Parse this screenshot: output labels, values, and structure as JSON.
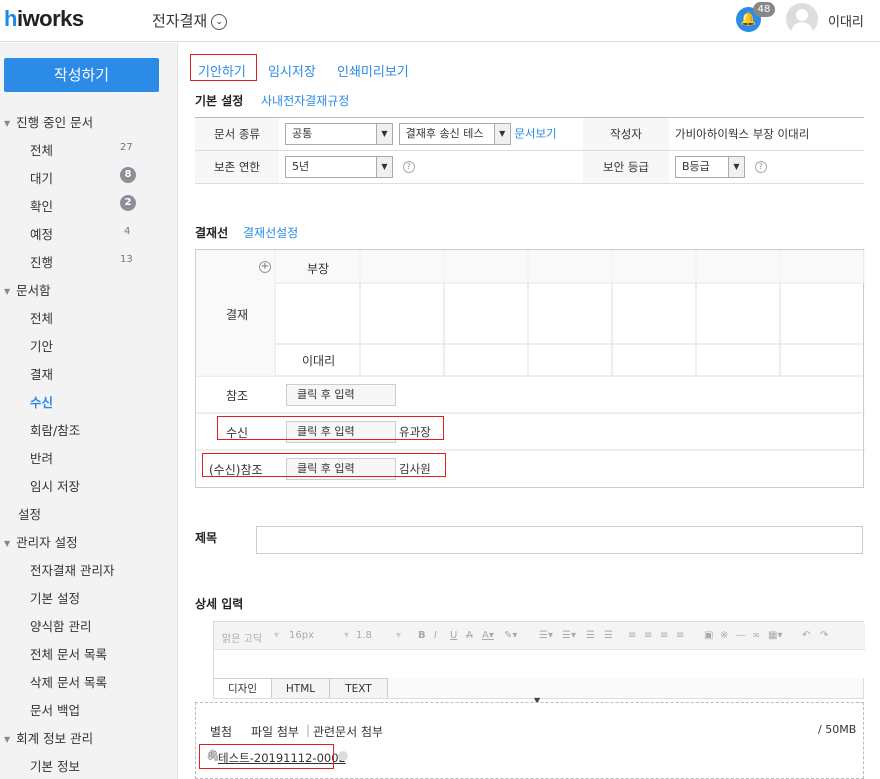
{
  "topbar": {
    "logo_h": "h",
    "logo_rest": "iworks",
    "app_title": "전자결재",
    "notif_count": "48",
    "user_name": "이대리"
  },
  "sidebar": {
    "write_button": "작성하기",
    "groups": [
      {
        "label": "진행 중인 문서"
      },
      {
        "label": "문서함"
      },
      {
        "label": "관리자 설정"
      },
      {
        "label": "회계 정보 관리"
      }
    ],
    "in_progress": [
      {
        "label": "전체",
        "count": "27"
      },
      {
        "label": "대기",
        "count": "8"
      },
      {
        "label": "확인",
        "count": "2"
      },
      {
        "label": "예정",
        "count": "4"
      },
      {
        "label": "진행",
        "count": "13"
      }
    ],
    "docbox": [
      "전체",
      "기안",
      "결재",
      "수신",
      "회람/참조",
      "반려",
      "임시 저장"
    ],
    "settings": "설정",
    "admin": [
      "전자결재 관리자",
      "기본 설정",
      "양식함 관리",
      "전체 문서 목록",
      "삭제 문서 목록",
      "문서 백업"
    ],
    "accounting": [
      "기본 정보"
    ]
  },
  "toolbar": {
    "draft": "기안하기",
    "temp_save": "임시저장",
    "print_preview": "인쇄미리보기"
  },
  "basic": {
    "title": "기본 설정",
    "rules_link": "사내전자결재규정",
    "doc_type_label": "문서 종류",
    "doc_type_value": "공통",
    "doc_type2_value": "결재후 송신 테스",
    "doc_view_link": "문서보기",
    "author_label": "작성자",
    "author_value": "가비아하이웍스 부장 이대리",
    "retention_label": "보존 연한",
    "retention_value": "5년",
    "security_label": "보안 등급",
    "security_value": "B등급"
  },
  "approval_line": {
    "title": "결재선",
    "settings_link": "결재선설정",
    "approve_label": "결재",
    "position": "부장",
    "approver": "이대리",
    "ref_label": "참조",
    "ref_placeholder": "클릭 후 입력",
    "recv_label": "수신",
    "recv_placeholder": "클릭 후 입력",
    "recv_value": "유과장",
    "recv_ref_label": "(수신)참조",
    "recv_ref_placeholder": "클릭 후 입력",
    "recv_ref_value": "김사원"
  },
  "subject": {
    "label": "제목"
  },
  "detail": {
    "label": "상세 입력",
    "font_family": "맑은 고딕",
    "font_size": "16px",
    "line_height": "1.8",
    "tabs": [
      "디자인",
      "HTML",
      "TEXT"
    ]
  },
  "attachment": {
    "label": "별첨",
    "file_attach": "파일 첨부",
    "related_attach": "관련문서 첨부",
    "limit": "/ 50MB",
    "file_name": "테스트-20191112-0002"
  },
  "colors": {
    "accent": "#2b8be6",
    "highlight": "#e02020"
  }
}
